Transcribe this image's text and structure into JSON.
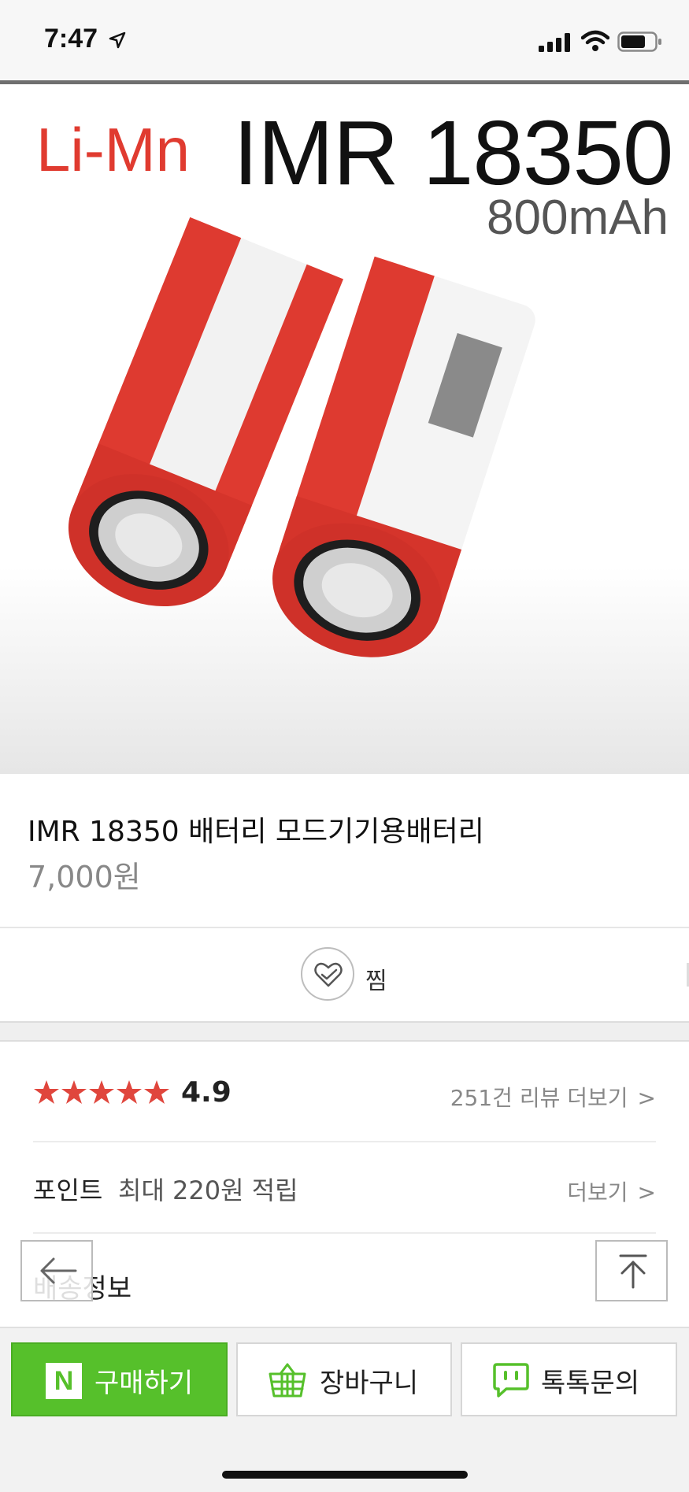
{
  "status_bar": {
    "time": "7:47"
  },
  "product_image": {
    "chemistry": "Li-Mn",
    "model": "IMR 18350",
    "capacity": "800mAh"
  },
  "product": {
    "title": "IMR 18350 배터리 모드기기용배터리",
    "price": "7,000원"
  },
  "wish": {
    "label": "찜"
  },
  "review": {
    "stars": 5,
    "rating": "4.9",
    "link": "251건 리뷰 더보기"
  },
  "point": {
    "label": "포인트",
    "value": "최대 220원 적립",
    "link": "더보기"
  },
  "shipping": {
    "label": "배송정보"
  },
  "bottom_bar": {
    "buy": "구매하기",
    "cart": "장바구니",
    "talk": "톡톡문의"
  },
  "colors": {
    "naver_green": "#56c02b",
    "star_red": "#e0463d",
    "battery_red": "#e03b30"
  }
}
